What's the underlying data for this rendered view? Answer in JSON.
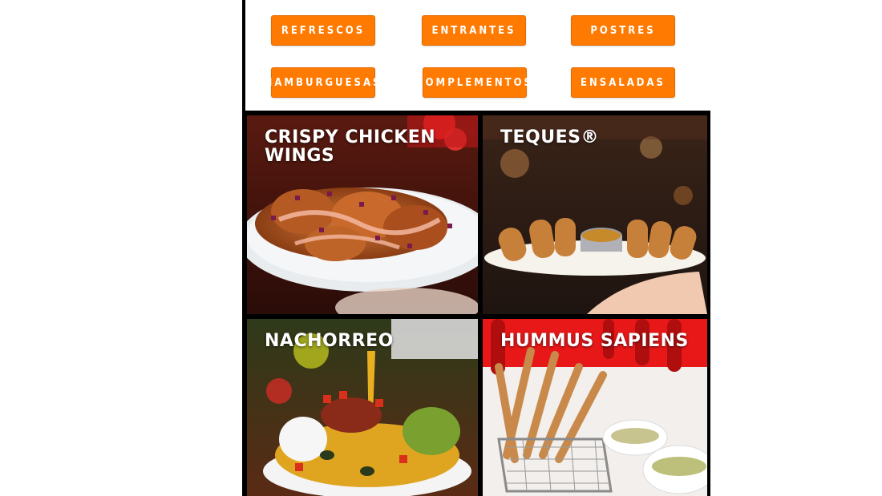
{
  "nav": {
    "row1": [
      {
        "label": "REFRESCOS"
      },
      {
        "label": "ENTRANTES"
      },
      {
        "label": "POSTRES"
      }
    ],
    "row2": [
      {
        "label": "HAMBURGUESAS"
      },
      {
        "label": "COMPLEMENTOS"
      },
      {
        "label": "ENSALADAS"
      }
    ]
  },
  "cards": [
    {
      "title": "CRISPY CHICKEN WINGS"
    },
    {
      "title": "TEQUES®"
    },
    {
      "title": "NACHORREO"
    },
    {
      "title": "HUMMUS SAPIENS"
    }
  ],
  "colors": {
    "accent": "#ff7a00",
    "border": "#000000"
  }
}
